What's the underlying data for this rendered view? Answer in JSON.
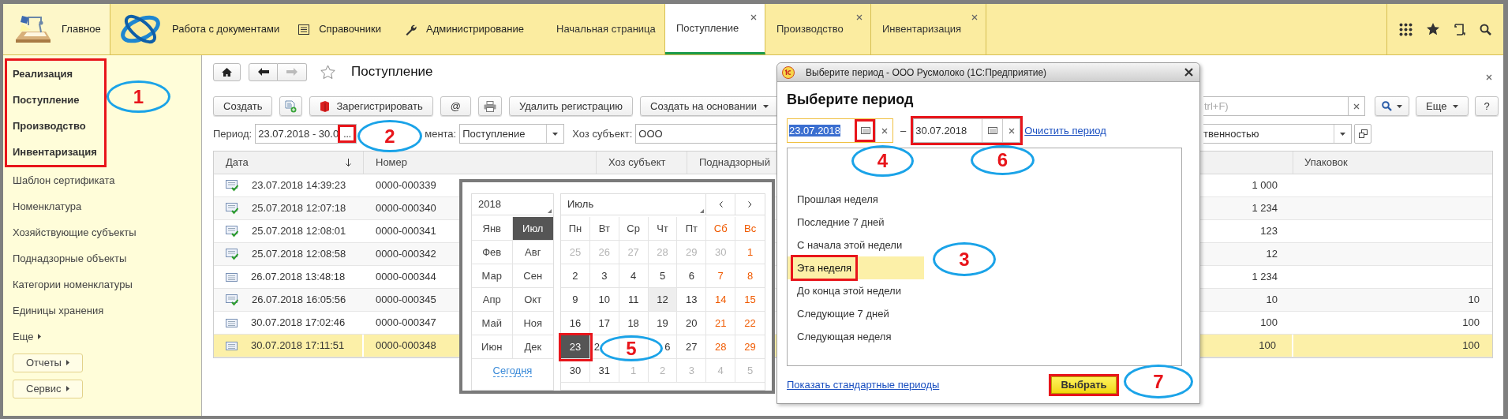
{
  "top_bar": {
    "sections": [
      {
        "label": "Главное",
        "kind": "home",
        "selected": true
      },
      {
        "label": "Работа с документами",
        "kind": "logo",
        "selected": false
      },
      {
        "label": "Справочники",
        "kind": "catalog",
        "selected": false
      },
      {
        "label": "Администрирование",
        "kind": "admin",
        "selected": false
      }
    ],
    "tabs": [
      {
        "label": "Начальная страница",
        "closable": false,
        "selected": false
      },
      {
        "label": "Поступление",
        "closable": true,
        "selected": true
      },
      {
        "label": "Производство",
        "closable": true,
        "selected": false
      },
      {
        "label": "Инвентаризация",
        "closable": true,
        "selected": false
      }
    ]
  },
  "sidebar": {
    "items": [
      {
        "label": "Реализация",
        "kind": "bold"
      },
      {
        "label": "Поступление",
        "kind": "bold"
      },
      {
        "label": "Производство",
        "kind": "bold"
      },
      {
        "label": "Инвентаризация",
        "kind": "bold"
      },
      {
        "label": "Шаблон сертификата",
        "kind": "link"
      },
      {
        "label": "Номенклатура",
        "kind": "link"
      },
      {
        "label": "Хозяйствующие субъекты",
        "kind": "link"
      },
      {
        "label": "Поднадзорные объекты",
        "kind": "link"
      },
      {
        "label": "Категории номенклатуры",
        "kind": "link"
      },
      {
        "label": "Единицы хранения",
        "kind": "link"
      },
      {
        "label": "Еще",
        "kind": "more"
      },
      {
        "label": "Отчеты",
        "kind": "button"
      },
      {
        "label": "Сервис",
        "kind": "button"
      }
    ]
  },
  "page": {
    "title": "Поступление",
    "toolbar": [
      {
        "kind": "text",
        "label": "Создать"
      },
      {
        "kind": "add"
      },
      {
        "kind": "register",
        "label": "Зарегистрировать"
      },
      {
        "kind": "text",
        "label": "@"
      },
      {
        "kind": "print"
      },
      {
        "kind": "text",
        "label": "Удалить регистрацию"
      },
      {
        "kind": "menu",
        "label": "Создать на основании"
      }
    ],
    "search": {
      "placeholder": "trl+F)"
    },
    "more_button": "Еще",
    "help_button": "?",
    "filters": {
      "period_label": "Период:",
      "period_value": "23.07.2018 - 30.0",
      "choose_button": "...",
      "doc_type_label": "мента:",
      "doc_type_value": "Поступление",
      "subject_label": "Хоз субъект:",
      "subject_value": "ООО",
      "extra_value": "твенностью"
    },
    "table": {
      "columns": [
        {
          "label": "Дата",
          "sorted": true
        },
        {
          "label": "Номер",
          "sorted": false
        },
        {
          "label": "Хоз субъект",
          "sorted": false
        },
        {
          "label": "Поднадзорный",
          "sorted": false
        },
        {
          "label": "Упаковок",
          "sorted": false
        }
      ],
      "rows": [
        {
          "posted": true,
          "date": "23.07.2018 14:39:23",
          "number": "0000-000339",
          "column_5": "1 000",
          "selected": false
        },
        {
          "posted": true,
          "date": "25.07.2018 12:07:18",
          "number": "0000-000340",
          "column_5": "1 234",
          "selected": false
        },
        {
          "posted": true,
          "date": "25.07.2018 12:08:01",
          "number": "0000-000341",
          "column_5": "123",
          "selected": false
        },
        {
          "posted": true,
          "date": "25.07.2018 12:08:58",
          "number": "0000-000342",
          "column_5": "12",
          "selected": false
        },
        {
          "posted": false,
          "date": "26.07.2018 13:48:18",
          "number": "0000-000344",
          "column_5": "1 234",
          "selected": false
        },
        {
          "posted": true,
          "date": "26.07.2018 16:05:56",
          "number": "0000-000345",
          "column_5": "10",
          "packages": "10",
          "selected": false
        },
        {
          "posted": false,
          "date": "30.07.2018 17:02:46",
          "number": "0000-000347",
          "column_5": "100",
          "packages": "100",
          "selected": false
        },
        {
          "posted": false,
          "date": "30.07.2018 17:11:51",
          "number": "0000-000348",
          "column_5": "100",
          "packages": "100",
          "selected": true
        }
      ]
    }
  },
  "calendar": {
    "year": "2018",
    "month": "Июль",
    "today_link": "Сегодня",
    "months": [
      {
        "label": "Янв",
        "selected": false
      },
      {
        "label": "Июл",
        "selected": true
      },
      {
        "label": "Фев",
        "selected": false
      },
      {
        "label": "Авг",
        "selected": false
      },
      {
        "label": "Мар",
        "selected": false
      },
      {
        "label": "Сен",
        "selected": false
      },
      {
        "label": "Апр",
        "selected": false
      },
      {
        "label": "Окт",
        "selected": false
      },
      {
        "label": "Май",
        "selected": false
      },
      {
        "label": "Ноя",
        "selected": false
      },
      {
        "label": "Июн",
        "selected": false
      },
      {
        "label": "Дек",
        "selected": false
      }
    ],
    "weekdays": [
      "Пн",
      "Вт",
      "Ср",
      "Чт",
      "Пт",
      "Сб",
      "Вс"
    ],
    "days": [
      {
        "day": "25",
        "muted": true,
        "today": false,
        "selected": false
      },
      {
        "day": "26",
        "muted": true,
        "today": false,
        "selected": false
      },
      {
        "day": "27",
        "muted": true,
        "today": false,
        "selected": false
      },
      {
        "day": "28",
        "muted": true,
        "today": false,
        "selected": false
      },
      {
        "day": "29",
        "muted": true,
        "today": false,
        "selected": false
      },
      {
        "day": "30",
        "muted": true,
        "today": false,
        "selected": false
      },
      {
        "day": "1",
        "muted": false,
        "today": false,
        "selected": false
      },
      {
        "day": "2",
        "muted": false,
        "today": false,
        "selected": false
      },
      {
        "day": "3",
        "muted": false,
        "today": false,
        "selected": false
      },
      {
        "day": "4",
        "muted": false,
        "today": false,
        "selected": false
      },
      {
        "day": "5",
        "muted": false,
        "today": false,
        "selected": false
      },
      {
        "day": "6",
        "muted": false,
        "today": false,
        "selected": false
      },
      {
        "day": "7",
        "muted": false,
        "today": false,
        "selected": false
      },
      {
        "day": "8",
        "muted": false,
        "today": false,
        "selected": false
      },
      {
        "day": "9",
        "muted": false,
        "today": false,
        "selected": false
      },
      {
        "day": "10",
        "muted": false,
        "today": false,
        "selected": false
      },
      {
        "day": "11",
        "muted": false,
        "today": false,
        "selected": false
      },
      {
        "day": "12",
        "muted": false,
        "today": true,
        "selected": false
      },
      {
        "day": "13",
        "muted": false,
        "today": false,
        "selected": false
      },
      {
        "day": "14",
        "muted": false,
        "today": false,
        "selected": false
      },
      {
        "day": "15",
        "muted": false,
        "today": false,
        "selected": false
      },
      {
        "day": "16",
        "muted": false,
        "today": false,
        "selected": false
      },
      {
        "day": "17",
        "muted": false,
        "today": false,
        "selected": false
      },
      {
        "day": "18",
        "muted": false,
        "today": false,
        "selected": false
      },
      {
        "day": "19",
        "muted": false,
        "today": false,
        "selected": false
      },
      {
        "day": "20",
        "muted": false,
        "today": false,
        "selected": false
      },
      {
        "day": "21",
        "muted": false,
        "today": false,
        "selected": false
      },
      {
        "day": "22",
        "muted": false,
        "today": false,
        "selected": false
      },
      {
        "day": "23",
        "muted": false,
        "today": false,
        "selected": true
      },
      {
        "day": "2",
        "muted": false,
        "today": false,
        "selected": false
      },
      {
        "day": "6",
        "muted": false,
        "today": false,
        "selected": false
      },
      {
        "day": "27",
        "muted": false,
        "today": false,
        "selected": false
      },
      {
        "day": "28",
        "muted": false,
        "today": false,
        "selected": false
      },
      {
        "day": "29",
        "muted": false,
        "today": false,
        "selected": false
      },
      {
        "day": "30",
        "muted": false,
        "today": false,
        "selected": false
      },
      {
        "day": "31",
        "muted": false,
        "today": false,
        "selected": false
      },
      {
        "day": "1",
        "muted": true,
        "today": false,
        "selected": false
      },
      {
        "day": "2",
        "muted": true,
        "today": false,
        "selected": false
      },
      {
        "day": "3",
        "muted": true,
        "today": false,
        "selected": false
      },
      {
        "day": "4",
        "muted": true,
        "today": false,
        "selected": false
      },
      {
        "day": "5",
        "muted": true,
        "today": false,
        "selected": false
      }
    ]
  },
  "dialog": {
    "title": "Выберите период - ООО Русмолоко (1С:Предприятие)",
    "heading": "Выберите период",
    "date_from": "23.07.2018",
    "separator": "–",
    "date_to": "30.07.2018",
    "clear_link": "Очистить период",
    "periods": [
      {
        "label": "Прошлая неделя",
        "selected": false
      },
      {
        "label": "Последние 7 дней",
        "selected": false
      },
      {
        "label": "С начала этой недели",
        "selected": false
      },
      {
        "label": "Эта неделя",
        "selected": true
      },
      {
        "label": "До конца этой недели",
        "selected": false
      },
      {
        "label": "Следующие 7 дней",
        "selected": false
      },
      {
        "label": "Следующая неделя",
        "selected": false
      }
    ],
    "standard_link": "Показать стандартные периоды",
    "ok_button": "Выбрать"
  },
  "callouts": [
    {
      "number": "1"
    },
    {
      "number": "2"
    },
    {
      "number": "3"
    },
    {
      "number": "4"
    },
    {
      "number": "5"
    },
    {
      "number": "6"
    },
    {
      "number": "7"
    }
  ]
}
